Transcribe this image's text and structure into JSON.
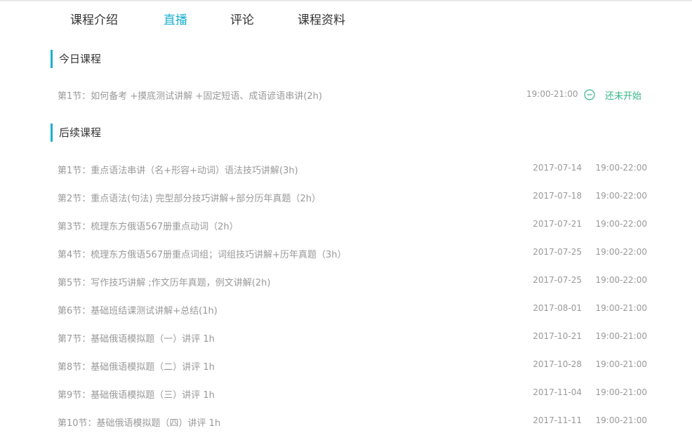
{
  "tabs": [
    {
      "label": "课程介绍",
      "active": false
    },
    {
      "label": "直播",
      "active": true
    },
    {
      "label": "评论",
      "active": false
    },
    {
      "label": "课程资料",
      "active": false
    }
  ],
  "colors": {
    "accent": "#1ab0d0",
    "status": "#33b586"
  },
  "today": {
    "title": "今日课程",
    "lesson": {
      "name": "第1节：如何备考 +摸底测试讲解 +固定短语、成语谚语串讲(2h)",
      "time": "19:00-21:00",
      "status_icon": "minus-circle-icon",
      "status": "还未开始"
    }
  },
  "upcoming": {
    "title": "后续课程",
    "lessons": [
      {
        "name": "第1节：重点语法串讲（名+形容+动词）语法技巧讲解(3h)",
        "date": "2017-07-14",
        "time": "19:00-22:00"
      },
      {
        "name": "第2节：重点语法(句法) 完型部分技巧讲解+部分历年真题（2h）",
        "date": "2017-07-18",
        "time": "19:00-22:00"
      },
      {
        "name": "第3节：梳理东方俄语567册重点动词（2h）",
        "date": "2017-07-21",
        "time": "19:00-22:00"
      },
      {
        "name": "第4节：梳理东方俄语567册重点词组；词组技巧讲解+历年真题（3h）",
        "date": "2017-07-25",
        "time": "19:00-22:00"
      },
      {
        "name": "第5节：写作技巧讲解 ;作文历年真题，例文讲解(2h)",
        "date": "2017-07-25",
        "time": "19:00-22:00"
      },
      {
        "name": "第6节：基础班结课测试讲解+总结(1h)",
        "date": "2017-08-01",
        "time": "19:00-21:00"
      },
      {
        "name": "第7节：基础俄语模拟题（一）讲评 1h",
        "date": "2017-10-21",
        "time": "19:00-21:00"
      },
      {
        "name": "第8节：基础俄语模拟题（二）讲评 1h",
        "date": "2017-10-28",
        "time": "19:00-21:00"
      },
      {
        "name": "第9节：基础俄语模拟题（三）讲评 1h",
        "date": "2017-11-04",
        "time": "19:00-21:00"
      },
      {
        "name": "第10节：基础俄语模拟题（四）讲评 1h",
        "date": "2017-11-11",
        "time": "19:00-21:00"
      }
    ]
  }
}
